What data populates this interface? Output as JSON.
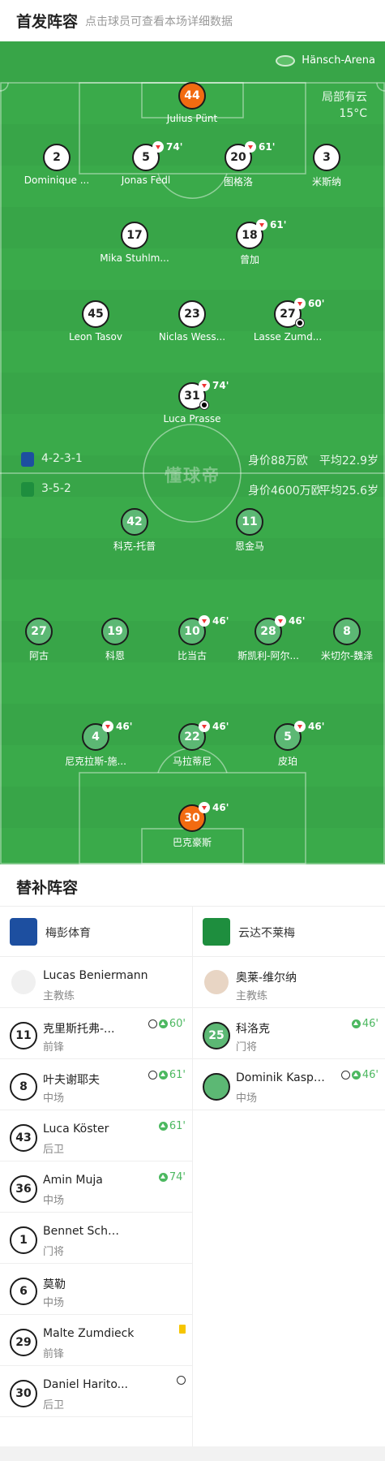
{
  "header": {
    "title": "首发阵容",
    "subtitle": "点击球员可查看本场详细数据"
  },
  "venue": "Hänsch-Arena",
  "weather": {
    "condition": "局部有云",
    "temp": "15°C"
  },
  "watermark": "懂球帝",
  "home_team": {
    "formation": "4-2-3-1",
    "value": "身价88万欧",
    "age": "平均22.9岁",
    "color": "#1d4fa0"
  },
  "away_team": {
    "formation": "3-5-2",
    "value": "身价4600万欧",
    "age": "平均25.6岁",
    "color": "#1e8e3e"
  },
  "home_players": [
    {
      "num": "44",
      "name": "Julius Pünt",
      "gk": true
    },
    {
      "num": "2",
      "name": "Dominique ..."
    },
    {
      "num": "5",
      "name": "Jonas Fedl",
      "sub": "74'"
    },
    {
      "num": "20",
      "name": "图格洛",
      "sub": "61'"
    },
    {
      "num": "3",
      "name": "米斯纳"
    },
    {
      "num": "17",
      "name": "Mika Stuhlm..."
    },
    {
      "num": "18",
      "name": "曾加",
      "sub": "61'"
    },
    {
      "num": "45",
      "name": "Leon Tasov"
    },
    {
      "num": "23",
      "name": "Niclas Wess..."
    },
    {
      "num": "27",
      "name": "Lasse Zumd...",
      "sub": "60'",
      "goal": true
    },
    {
      "num": "31",
      "name": "Luca Prasse",
      "sub": "74'",
      "goal": true
    }
  ],
  "away_players": [
    {
      "num": "42",
      "name": "科克-托普"
    },
    {
      "num": "11",
      "name": "恩金马"
    },
    {
      "num": "27",
      "name": "阿古"
    },
    {
      "num": "19",
      "name": "科恩"
    },
    {
      "num": "10",
      "name": "比当古",
      "sub": "46'"
    },
    {
      "num": "28",
      "name": "斯凯利-阿尔...",
      "sub": "46'"
    },
    {
      "num": "8",
      "name": "米切尔-魏泽"
    },
    {
      "num": "4",
      "name": "尼克拉斯-施...",
      "sub": "46'"
    },
    {
      "num": "22",
      "name": "马拉蒂尼",
      "sub": "46'"
    },
    {
      "num": "5",
      "name": "皮珀",
      "sub": "46'"
    },
    {
      "num": "30",
      "name": "巴克豪斯",
      "sub": "46'",
      "gk": true
    }
  ],
  "subs": {
    "title": "替补阵容",
    "home": {
      "team": "梅彭体育",
      "coach": {
        "name": "Lucas Beniermann",
        "role": "主教练"
      },
      "players": [
        {
          "num": "11",
          "name": "克里斯托弗-...",
          "pos": "前锋",
          "ev": "60'",
          "goal": true,
          "up": true
        },
        {
          "num": "8",
          "name": "叶夫谢耶夫",
          "pos": "中场",
          "ev": "61'",
          "goal": true,
          "up": true
        },
        {
          "num": "43",
          "name": "Luca Köster",
          "pos": "后卫",
          "ev": "61'",
          "up": true
        },
        {
          "num": "36",
          "name": "Amin Muja",
          "pos": "中场",
          "ev": "74'",
          "up": true
        },
        {
          "num": "1",
          "name": "Bennet Schmidt",
          "pos": "门将"
        },
        {
          "num": "6",
          "name": "莫勒",
          "pos": "中场"
        },
        {
          "num": "29",
          "name": "Malte Zumdieck",
          "pos": "前锋",
          "card": true
        },
        {
          "num": "30",
          "name": "Daniel Harito...",
          "pos": "后卫",
          "goal": true
        }
      ]
    },
    "away": {
      "team": "云达不莱梅",
      "coach": {
        "name": "奥莱-维尔纳",
        "role": "主教练"
      },
      "players": [
        {
          "num": "25",
          "name": "科洛克",
          "pos": "门将",
          "ev": "46'",
          "up": true
        },
        {
          "num": "",
          "name": "Dominik Kasper",
          "pos": "中场",
          "ev": "46'",
          "goal": true,
          "up": true
        }
      ]
    }
  }
}
